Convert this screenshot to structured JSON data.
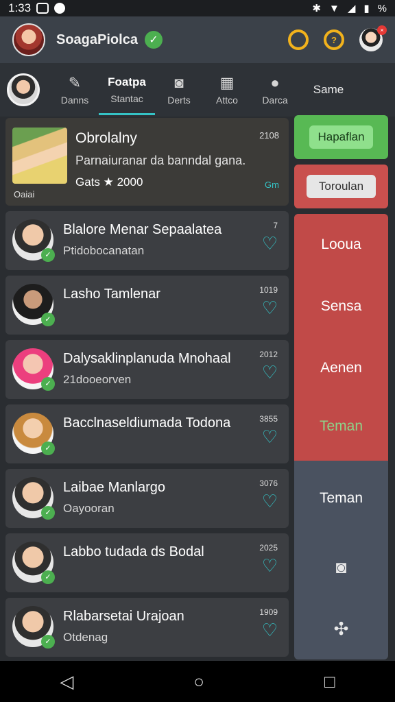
{
  "status": {
    "time": "1:33",
    "battery": "%"
  },
  "header": {
    "title": "SoagaPiolca"
  },
  "tabs": {
    "items": [
      {
        "label": "Danns"
      },
      {
        "label_top": "Foatpa",
        "label": "Stantac"
      },
      {
        "label": "Derts"
      },
      {
        "label": "Attco"
      },
      {
        "label": "Darca"
      },
      {
        "label": "Same"
      }
    ]
  },
  "feature": {
    "title": "Obrolalny",
    "description": "Parnaiuranar da banndal gana.",
    "meta": "Gats ★ 2000",
    "number": "2108",
    "badge": "Gm",
    "thumb_label": "Oaiai"
  },
  "rows": [
    {
      "name": "Blalore Menar Sepaalatea",
      "sub": "Ptidobocanatan",
      "number": "7"
    },
    {
      "name": "Lasho Tamlenar",
      "sub": "",
      "number": "1019"
    },
    {
      "name": "Dalysaklinplanuda Mnohaal",
      "sub": "21dooeorven",
      "number": "2012"
    },
    {
      "name": "Bacclnaseldiumada Todona",
      "sub": "",
      "number": "3855"
    },
    {
      "name": "Laibae Manlargo",
      "sub": "Oayooran",
      "number": "3076"
    },
    {
      "name": "Labbo tudada ds Bodal",
      "sub": "",
      "number": "2025"
    },
    {
      "name": "Rlabarsetai Urajoan",
      "sub": "Otdenag",
      "number": "1909"
    }
  ],
  "side": {
    "button_primary": "Hapaflan",
    "button_secondary": "Toroulan",
    "items": [
      "Looua",
      "Sensa",
      "Aenen",
      "Teman",
      "Teman"
    ]
  }
}
